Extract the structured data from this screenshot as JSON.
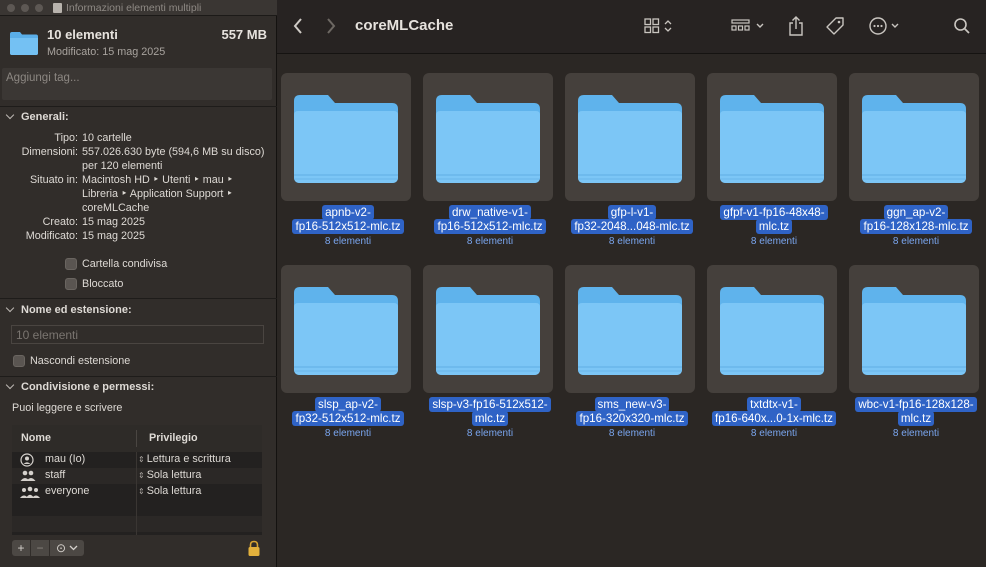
{
  "finder": {
    "folder_title": "coreMLCache",
    "items": [
      {
        "line1": "apnb-v2-",
        "line2": "fp16-512x512-mlc.tz",
        "count": "8 elementi"
      },
      {
        "line1": "drw_native-v1-",
        "line2": "fp16-512x512-mlc.tz",
        "count": "8 elementi"
      },
      {
        "line1": "gfp-l-v1-",
        "line2": "fp32-2048...048-mlc.tz",
        "count": "8 elementi"
      },
      {
        "line1": "gfpf-v1-fp16-48x48-",
        "line2": "mlc.tz",
        "count": "8 elementi"
      },
      {
        "line1": "ggn_ap-v2-",
        "line2": "fp16-128x128-mlc.tz",
        "count": "8 elementi"
      },
      {
        "line1": "slsp_ap-v2-",
        "line2": "fp32-512x512-mlc.tz",
        "count": "8 elementi"
      },
      {
        "line1": "slsp-v3-fp16-512x512-",
        "line2": "mlc.tz",
        "count": "8 elementi"
      },
      {
        "line1": "sms_new-v3-",
        "line2": "fp16-320x320-mlc.tz",
        "count": "8 elementi"
      },
      {
        "line1": "txtdtx-v1-",
        "line2": "fp16-640x...0-1x-mlc.tz",
        "count": "8 elementi"
      },
      {
        "line1": "wbc-v1-fp16-128x128-",
        "line2": "mlc.tz",
        "count": "8 elementi"
      }
    ]
  },
  "info": {
    "window_title": "Informazioni elementi multipli",
    "name": "10 elementi",
    "size": "557 MB",
    "modified_header": "Modificato: 15 mag 2025",
    "tags_placeholder": "Aggiungi tag...",
    "general": {
      "heading": "Generali:",
      "rows": [
        {
          "k": "Tipo:",
          "v": "10 cartelle"
        },
        {
          "k": "Dimensioni:",
          "v": "557.026.630 byte (594,6 MB su disco) per 120 elementi"
        },
        {
          "k": "Situato in:",
          "v": "Macintosh HD ‣ Utenti ‣ mau ‣ Libreria ‣ Application Support ‣ coreMLCache"
        },
        {
          "k": "Creato:",
          "v": "15 mag 2025"
        },
        {
          "k": "Modificato:",
          "v": "15 mag 2025"
        }
      ],
      "shared_folder": "Cartella condivisa",
      "locked": "Bloccato"
    },
    "name_ext": {
      "heading": "Nome ed estensione:",
      "placeholder": "10 elementi",
      "hide_ext": "Nascondi estensione"
    },
    "sharing": {
      "heading": "Condivisione e permessi:",
      "summary": "Puoi leggere e scrivere",
      "col_name": "Nome",
      "col_priv": "Privilegio",
      "rows": [
        {
          "name": "mau (Io)",
          "priv": "Lettura e scrittura"
        },
        {
          "name": "staff",
          "priv": "Sola lettura"
        },
        {
          "name": "everyone",
          "priv": "Sola lettura"
        }
      ],
      "add": "+",
      "remove": "−",
      "action": "⊙"
    }
  }
}
